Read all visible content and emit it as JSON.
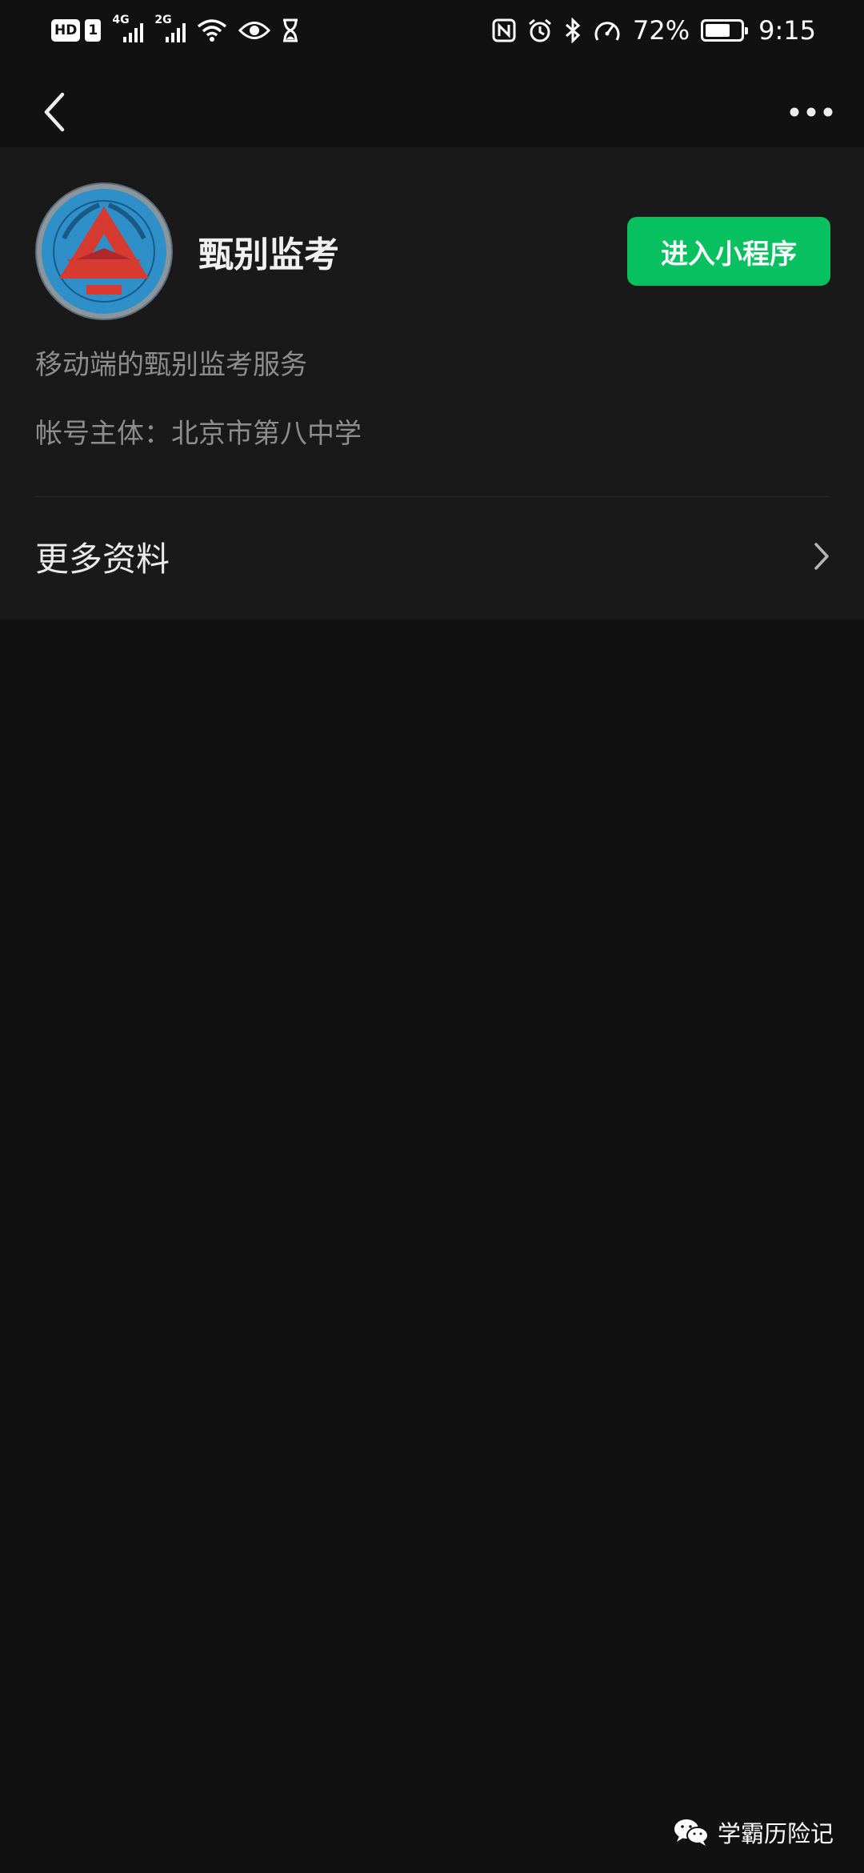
{
  "status_bar": {
    "hd_label": "HD",
    "sim_label": "1",
    "net1_label": "4G",
    "net2_label": "2G",
    "battery_text": "72%",
    "battery_level": 0.72,
    "time": "9:15",
    "icons": [
      "nfc-icon",
      "alarm-icon",
      "bluetooth-icon",
      "speed-icon",
      "wifi-icon",
      "eye-icon",
      "hourglass-icon"
    ]
  },
  "nav": {
    "back_icon": "chevron-left-icon",
    "more_icon": "more-dots-icon"
  },
  "profile": {
    "name": "甄别监考",
    "enter_button": "进入小程序",
    "description": "移动端的甄别监考服务",
    "account_label": "帐号主体：",
    "account_value": "北京市第八中学"
  },
  "more_info": {
    "label": "更多资料",
    "chevron": "chevron-right-icon"
  },
  "watermark": {
    "text": "学霸历险记",
    "icon": "wechat-icon"
  },
  "colors": {
    "background": "#111111",
    "card": "#191919",
    "accent_green": "#07c160",
    "secondary_text": "#8d8d8d"
  }
}
